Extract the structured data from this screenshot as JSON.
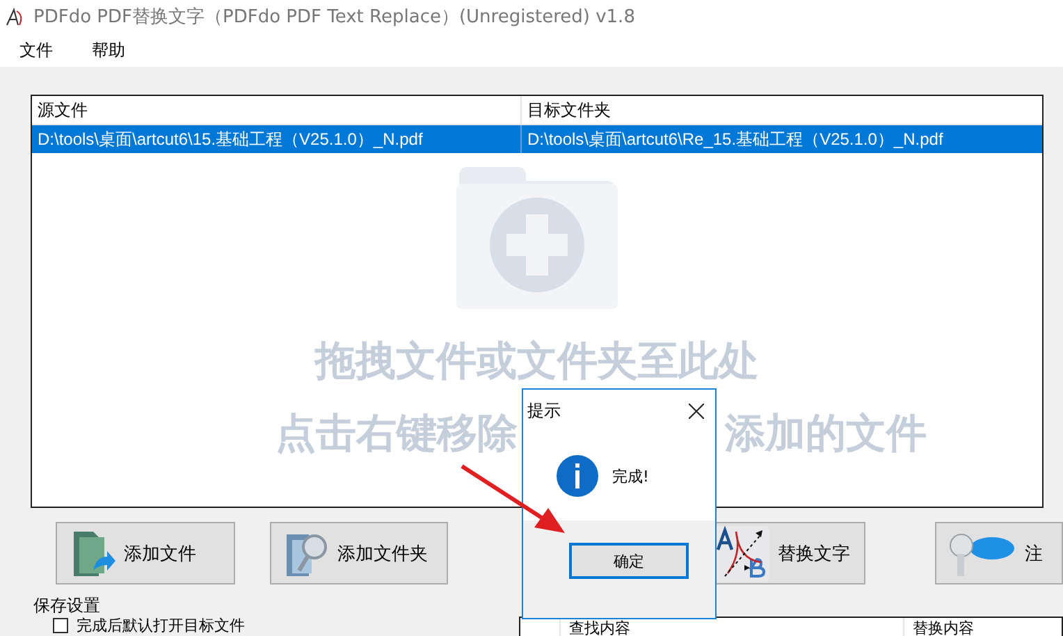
{
  "window": {
    "title": "PDFdo PDF替换文字（PDFdo PDF Text Replace）(Unregistered) v1.8"
  },
  "menu": [
    "文件",
    "帮助"
  ],
  "file_list": {
    "columns": [
      "源文件",
      "目标文件夹"
    ],
    "rows": [
      {
        "cells": [
          "D:\\tools\\桌面\\artcut6\\15.基础工程（V25.1.0）_N.pdf",
          "D:\\tools\\桌面\\artcut6\\Re_15.基础工程（V25.1.0）_N.pdf"
        ],
        "selected": true
      }
    ],
    "drop_hint": "拖拽文件或文件夹至此处",
    "remove_hint_parts": [
      "点击右键移除",
      "添加的文件"
    ]
  },
  "buttons": [
    {
      "kind": "add-file",
      "label": "添加文件"
    },
    {
      "kind": "add-folder",
      "label": "添加文件夹"
    },
    {
      "kind": "replace",
      "label": "替换文字"
    },
    {
      "kind": "register",
      "label": "注"
    }
  ],
  "save_settings": {
    "title": "保存设置",
    "options": [
      {
        "label": "完成后默认打开目标文件",
        "checked": false
      }
    ]
  },
  "replace_table": {
    "columns": [
      "查找内容",
      "替换内容"
    ]
  },
  "dialog": {
    "title": "提示",
    "message": "完成!",
    "button": "确定"
  }
}
